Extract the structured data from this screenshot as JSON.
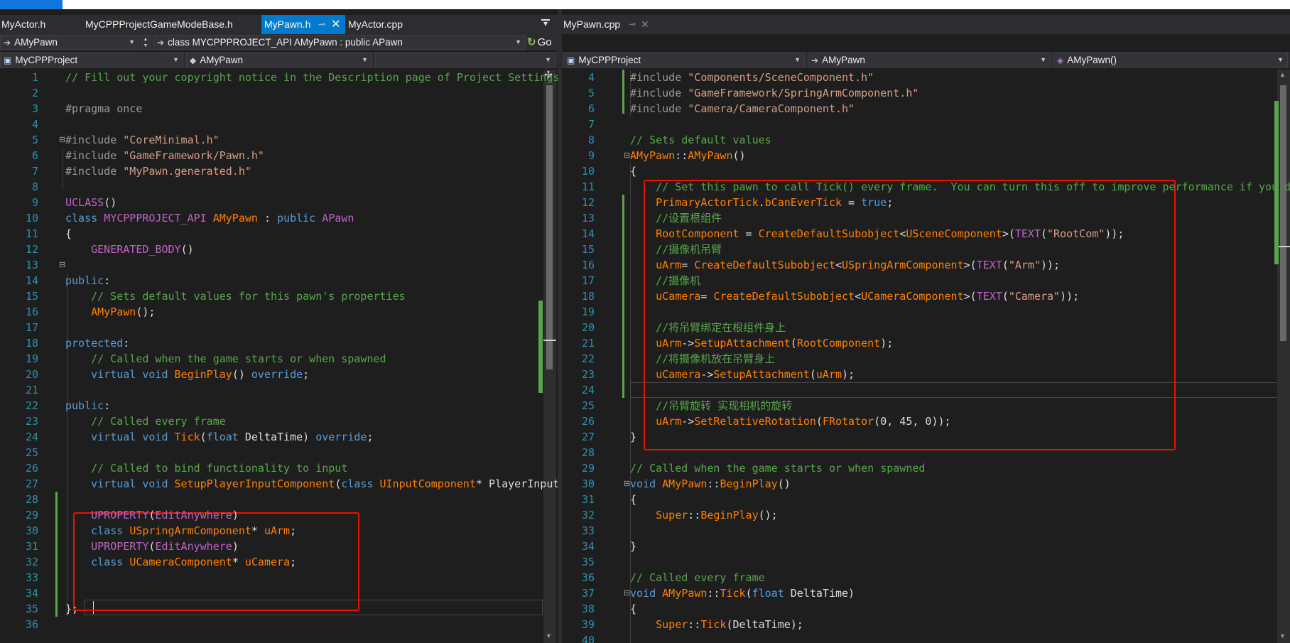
{
  "left_pane": {
    "tabs": [
      {
        "label": "MyActor.h",
        "active": false
      },
      {
        "label": "MyCPPProjectGameModeBase.h",
        "active": false
      },
      {
        "label": "MyPawn.h",
        "active": true
      },
      {
        "label": "MyActor.cpp",
        "active": false
      }
    ],
    "nav": {
      "type_combo": "AMyPawn",
      "scope_combo": "class MYCPPPROJECT_API AMyPawn : public APawn",
      "go_button": "Go",
      "project_combo": "MyCPPProject",
      "class_combo": "AMyPawn",
      "member_combo": ""
    },
    "lines": [
      {
        "n": "1",
        "seg": [
          [
            "c",
            "// Fill out your copyright notice in the Description page of Project Settings."
          ]
        ]
      },
      {
        "n": "2",
        "seg": []
      },
      {
        "n": "3",
        "seg": [
          [
            "p",
            "#pragma once"
          ]
        ]
      },
      {
        "n": "4",
        "seg": []
      },
      {
        "n": "5",
        "seg": [
          [
            "p",
            "#include "
          ],
          [
            "s",
            "\"CoreMinimal.h\""
          ]
        ]
      },
      {
        "n": "6",
        "seg": [
          [
            "p",
            "#include "
          ],
          [
            "s",
            "\"GameFramework/Pawn.h\""
          ]
        ]
      },
      {
        "n": "7",
        "seg": [
          [
            "p",
            "#include "
          ],
          [
            "s",
            "\"MyPawn.generated.h\""
          ]
        ]
      },
      {
        "n": "8",
        "seg": []
      },
      {
        "n": "9",
        "seg": [
          [
            "m",
            "UCLASS"
          ],
          [
            "n",
            "()"
          ]
        ]
      },
      {
        "n": "10",
        "seg": [
          [
            "k",
            "class "
          ],
          [
            "m",
            "MYCPPPROJECT_API "
          ],
          [
            "f",
            "AMyPawn"
          ],
          [
            "n",
            " : "
          ],
          [
            "k",
            "public "
          ],
          [
            "m",
            "APawn"
          ]
        ]
      },
      {
        "n": "11",
        "seg": [
          [
            "n",
            "{"
          ]
        ]
      },
      {
        "n": "12",
        "seg": [
          [
            "n",
            "    "
          ],
          [
            "m",
            "GENERATED_BODY"
          ],
          [
            "n",
            "()"
          ]
        ]
      },
      {
        "n": "13",
        "seg": []
      },
      {
        "n": "14",
        "seg": [
          [
            "k",
            "public"
          ],
          [
            "n",
            ":"
          ]
        ]
      },
      {
        "n": "15",
        "seg": [
          [
            "n",
            "    "
          ],
          [
            "c",
            "// Sets default values for this pawn's properties"
          ]
        ]
      },
      {
        "n": "16",
        "seg": [
          [
            "n",
            "    "
          ],
          [
            "f",
            "AMyPawn"
          ],
          [
            "n",
            "();"
          ]
        ]
      },
      {
        "n": "17",
        "seg": []
      },
      {
        "n": "18",
        "seg": [
          [
            "k",
            "protected"
          ],
          [
            "n",
            ":"
          ]
        ]
      },
      {
        "n": "19",
        "seg": [
          [
            "n",
            "    "
          ],
          [
            "c",
            "// Called when the game starts or when spawned"
          ]
        ]
      },
      {
        "n": "20",
        "seg": [
          [
            "n",
            "    "
          ],
          [
            "k",
            "virtual void "
          ],
          [
            "f",
            "BeginPlay"
          ],
          [
            "n",
            "() "
          ],
          [
            "k",
            "override"
          ],
          [
            "n",
            ";"
          ]
        ]
      },
      {
        "n": "21",
        "seg": []
      },
      {
        "n": "22",
        "seg": [
          [
            "k",
            "public"
          ],
          [
            "n",
            ":"
          ]
        ]
      },
      {
        "n": "23",
        "seg": [
          [
            "n",
            "    "
          ],
          [
            "c",
            "// Called every frame"
          ]
        ]
      },
      {
        "n": "24",
        "seg": [
          [
            "n",
            "    "
          ],
          [
            "k",
            "virtual void "
          ],
          [
            "f",
            "Tick"
          ],
          [
            "n",
            "("
          ],
          [
            "k",
            "float "
          ],
          [
            "n",
            "DeltaTime) "
          ],
          [
            "k",
            "override"
          ],
          [
            "n",
            ";"
          ]
        ]
      },
      {
        "n": "25",
        "seg": []
      },
      {
        "n": "26",
        "seg": [
          [
            "n",
            "    "
          ],
          [
            "c",
            "// Called to bind functionality to input"
          ]
        ]
      },
      {
        "n": "27",
        "seg": [
          [
            "n",
            "    "
          ],
          [
            "k",
            "virtual void "
          ],
          [
            "f",
            "SetupPlayerInputComponent"
          ],
          [
            "n",
            "("
          ],
          [
            "k",
            "class "
          ],
          [
            "f",
            "UInputComponent"
          ],
          [
            "n",
            "* PlayerInputComponent) "
          ],
          [
            "k",
            "override"
          ],
          [
            "n",
            ";"
          ]
        ]
      },
      {
        "n": "28",
        "seg": []
      },
      {
        "n": "29",
        "seg": [
          [
            "n",
            "    "
          ],
          [
            "m",
            "UPROPERTY"
          ],
          [
            "n",
            "("
          ],
          [
            "m",
            "EditAnywhere"
          ],
          [
            "n",
            ")"
          ]
        ]
      },
      {
        "n": "30",
        "seg": [
          [
            "n",
            "    "
          ],
          [
            "k",
            "class "
          ],
          [
            "f",
            "USpringArmComponent"
          ],
          [
            "n",
            "* "
          ],
          [
            "f",
            "uArm"
          ],
          [
            "n",
            ";"
          ]
        ]
      },
      {
        "n": "31",
        "seg": [
          [
            "n",
            "    "
          ],
          [
            "m",
            "UPROPERTY"
          ],
          [
            "n",
            "("
          ],
          [
            "m",
            "EditAnywhere"
          ],
          [
            "n",
            ")"
          ]
        ]
      },
      {
        "n": "32",
        "seg": [
          [
            "n",
            "    "
          ],
          [
            "k",
            "class "
          ],
          [
            "f",
            "UCameraComponent"
          ],
          [
            "n",
            "* "
          ],
          [
            "f",
            "uCamera"
          ],
          [
            "n",
            ";"
          ]
        ]
      },
      {
        "n": "33",
        "seg": []
      },
      {
        "n": "34",
        "seg": []
      },
      {
        "n": "35",
        "seg": [
          [
            "n",
            "};"
          ]
        ]
      },
      {
        "n": "36",
        "seg": []
      }
    ]
  },
  "right_pane": {
    "tabs": [
      {
        "label": "MyPawn.cpp",
        "active": false
      }
    ],
    "nav": {
      "project_combo": "MyCPPProject",
      "class_combo": "AMyPawn",
      "member_combo": "AMyPawn()"
    },
    "lines": [
      {
        "n": "4",
        "seg": [
          [
            "p",
            "#include "
          ],
          [
            "s",
            "\"Components/SceneComponent.h\""
          ]
        ]
      },
      {
        "n": "5",
        "seg": [
          [
            "p",
            "#include "
          ],
          [
            "s",
            "\"GameFramework/SpringArmComponent.h\""
          ]
        ]
      },
      {
        "n": "6",
        "seg": [
          [
            "p",
            "#include "
          ],
          [
            "s",
            "\"Camera/CameraComponent.h\""
          ]
        ]
      },
      {
        "n": "7",
        "seg": []
      },
      {
        "n": "8",
        "seg": [
          [
            "c",
            "// Sets default values"
          ]
        ]
      },
      {
        "n": "9",
        "seg": [
          [
            "f",
            "AMyPawn"
          ],
          [
            "n",
            "::"
          ],
          [
            "f",
            "AMyPawn"
          ],
          [
            "n",
            "()"
          ]
        ]
      },
      {
        "n": "10",
        "seg": [
          [
            "n",
            "{"
          ]
        ]
      },
      {
        "n": "11",
        "seg": [
          [
            "n",
            "    "
          ],
          [
            "c",
            "// Set this pawn to call Tick() every frame.  You can turn this off to improve performance if you don't need it."
          ]
        ]
      },
      {
        "n": "12",
        "seg": [
          [
            "n",
            "    "
          ],
          [
            "f",
            "PrimaryActorTick"
          ],
          [
            "n",
            "."
          ],
          [
            "f",
            "bCanEverTick"
          ],
          [
            "n",
            " = "
          ],
          [
            "k",
            "true"
          ],
          [
            "n",
            ";"
          ]
        ]
      },
      {
        "n": "13",
        "seg": [
          [
            "n",
            "    "
          ],
          [
            "c",
            "//设置根组件"
          ]
        ]
      },
      {
        "n": "14",
        "seg": [
          [
            "n",
            "    "
          ],
          [
            "f",
            "RootComponent"
          ],
          [
            "n",
            " = "
          ],
          [
            "f",
            "CreateDefaultSubobject"
          ],
          [
            "n",
            "<"
          ],
          [
            "f",
            "USceneComponent"
          ],
          [
            "n",
            ">("
          ],
          [
            "m",
            "TEXT"
          ],
          [
            "n",
            "("
          ],
          [
            "s",
            "\"RootCom\""
          ],
          [
            "n",
            "));"
          ]
        ]
      },
      {
        "n": "15",
        "seg": [
          [
            "n",
            "    "
          ],
          [
            "c",
            "//摄像机吊臂"
          ]
        ]
      },
      {
        "n": "16",
        "seg": [
          [
            "n",
            "    "
          ],
          [
            "f",
            "uArm"
          ],
          [
            "n",
            "= "
          ],
          [
            "f",
            "CreateDefaultSubobject"
          ],
          [
            "n",
            "<"
          ],
          [
            "f",
            "USpringArmComponent"
          ],
          [
            "n",
            ">("
          ],
          [
            "m",
            "TEXT"
          ],
          [
            "n",
            "("
          ],
          [
            "s",
            "\"Arm\""
          ],
          [
            "n",
            "));"
          ]
        ]
      },
      {
        "n": "17",
        "seg": [
          [
            "n",
            "    "
          ],
          [
            "c",
            "//摄像机"
          ]
        ]
      },
      {
        "n": "18",
        "seg": [
          [
            "n",
            "    "
          ],
          [
            "f",
            "uCamera"
          ],
          [
            "n",
            "= "
          ],
          [
            "f",
            "CreateDefaultSubobject"
          ],
          [
            "n",
            "<"
          ],
          [
            "f",
            "UCameraComponent"
          ],
          [
            "n",
            ">("
          ],
          [
            "m",
            "TEXT"
          ],
          [
            "n",
            "("
          ],
          [
            "s",
            "\"Camera\""
          ],
          [
            "n",
            "));"
          ]
        ]
      },
      {
        "n": "19",
        "seg": []
      },
      {
        "n": "20",
        "seg": [
          [
            "n",
            "    "
          ],
          [
            "c",
            "//将吊臂绑定在根组件身上"
          ]
        ]
      },
      {
        "n": "21",
        "seg": [
          [
            "n",
            "    "
          ],
          [
            "f",
            "uArm"
          ],
          [
            "n",
            "->"
          ],
          [
            "f",
            "SetupAttachment"
          ],
          [
            "n",
            "("
          ],
          [
            "f",
            "RootComponent"
          ],
          [
            "n",
            ");"
          ]
        ]
      },
      {
        "n": "22",
        "seg": [
          [
            "n",
            "    "
          ],
          [
            "c",
            "//将摄像机放在吊臂身上"
          ]
        ]
      },
      {
        "n": "23",
        "seg": [
          [
            "n",
            "    "
          ],
          [
            "f",
            "uCamera"
          ],
          [
            "n",
            "->"
          ],
          [
            "f",
            "SetupAttachment"
          ],
          [
            "n",
            "("
          ],
          [
            "f",
            "uArm"
          ],
          [
            "n",
            ");"
          ]
        ]
      },
      {
        "n": "24",
        "seg": []
      },
      {
        "n": "25",
        "seg": [
          [
            "n",
            "    "
          ],
          [
            "c",
            "//吊臂旋转 实现相机的旋转"
          ]
        ]
      },
      {
        "n": "26",
        "seg": [
          [
            "n",
            "    "
          ],
          [
            "f",
            "uArm"
          ],
          [
            "n",
            "->"
          ],
          [
            "f",
            "SetRelativeRotation"
          ],
          [
            "n",
            "("
          ],
          [
            "f",
            "FRotator"
          ],
          [
            "n",
            "(0, 45, 0));"
          ]
        ]
      },
      {
        "n": "27",
        "seg": [
          [
            "n",
            "}"
          ]
        ]
      },
      {
        "n": "28",
        "seg": []
      },
      {
        "n": "29",
        "seg": [
          [
            "c",
            "// Called when the game starts or when spawned"
          ]
        ]
      },
      {
        "n": "30",
        "seg": [
          [
            "k",
            "void "
          ],
          [
            "f",
            "AMyPawn"
          ],
          [
            "n",
            "::"
          ],
          [
            "f",
            "BeginPlay"
          ],
          [
            "n",
            "()"
          ]
        ]
      },
      {
        "n": "31",
        "seg": [
          [
            "n",
            "{"
          ]
        ]
      },
      {
        "n": "32",
        "seg": [
          [
            "n",
            "    "
          ],
          [
            "f",
            "Super"
          ],
          [
            "n",
            "::"
          ],
          [
            "f",
            "BeginPlay"
          ],
          [
            "n",
            "();"
          ]
        ]
      },
      {
        "n": "33",
        "seg": []
      },
      {
        "n": "34",
        "seg": [
          [
            "n",
            "}"
          ]
        ]
      },
      {
        "n": "35",
        "seg": []
      },
      {
        "n": "36",
        "seg": [
          [
            "c",
            "// Called every frame"
          ]
        ]
      },
      {
        "n": "37",
        "seg": [
          [
            "k",
            "void "
          ],
          [
            "f",
            "AMyPawn"
          ],
          [
            "n",
            "::"
          ],
          [
            "f",
            "Tick"
          ],
          [
            "n",
            "("
          ],
          [
            "k",
            "float "
          ],
          [
            "n",
            "DeltaTime)"
          ]
        ]
      },
      {
        "n": "38",
        "seg": [
          [
            "n",
            "{"
          ]
        ]
      },
      {
        "n": "39",
        "seg": [
          [
            "n",
            "    "
          ],
          [
            "f",
            "Super"
          ],
          [
            "n",
            "::"
          ],
          [
            "f",
            "Tick"
          ],
          [
            "n",
            "(DeltaTime);"
          ]
        ]
      },
      {
        "n": "40",
        "seg": []
      }
    ]
  },
  "icons": {
    "tab_pin": "pin-icon",
    "tab_close": "close-icon",
    "nav_arrow": "arrow-right-icon",
    "go": "go-icon",
    "project": "project-icon",
    "class": "class-icon",
    "method": "method-icon"
  },
  "colors": {
    "editor_bg": "#1e1e1e",
    "chrome_bg": "#2d2d30",
    "active_tab": "#007acc",
    "keyword": "#569cd6",
    "comment": "#57a64a",
    "string": "#d69d85",
    "macro": "#bd63c5",
    "identifier": "#ff8000",
    "line_number": "#2b91af",
    "annotation_box": "#e51400"
  }
}
